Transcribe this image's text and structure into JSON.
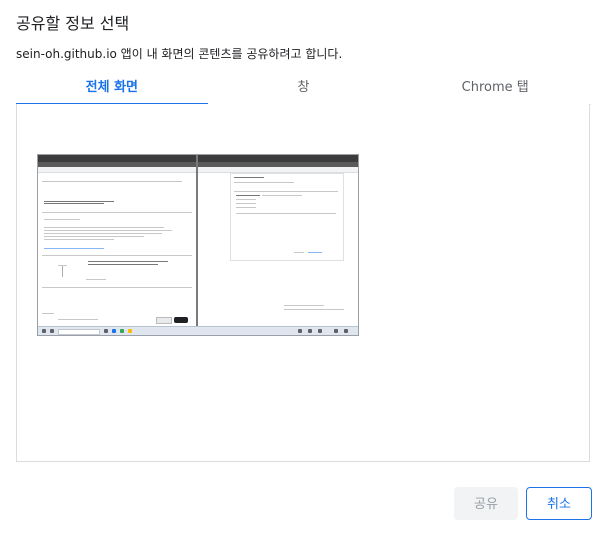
{
  "dialog": {
    "title": "공유할 정보 선택",
    "subtitle": "sein-oh.github.io 앱이 내 화면의 콘텐츠를 공유하려고 합니다."
  },
  "tabs": [
    {
      "label": "전체 화면",
      "active": true
    },
    {
      "label": "창",
      "active": false
    },
    {
      "label": "Chrome 탭",
      "active": false
    }
  ],
  "buttons": {
    "share_label": "공유",
    "cancel_label": "취소"
  },
  "colors": {
    "accent": "#1a73e8",
    "disabled_bg": "#f1f3f4",
    "disabled_text": "#9aa0a6",
    "border": "#dadce0"
  }
}
